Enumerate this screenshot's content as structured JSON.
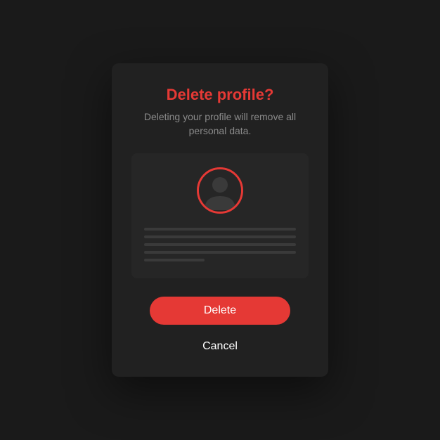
{
  "modal": {
    "title": "Delete profile?",
    "subtitle": "Deleting your profile will remove all personal data.",
    "deleteLabel": "Delete",
    "cancelLabel": "Cancel"
  },
  "colors": {
    "accent": "#e53935",
    "background": "#1a1a1a",
    "modalBg": "#212121",
    "cardBg": "#262626"
  }
}
